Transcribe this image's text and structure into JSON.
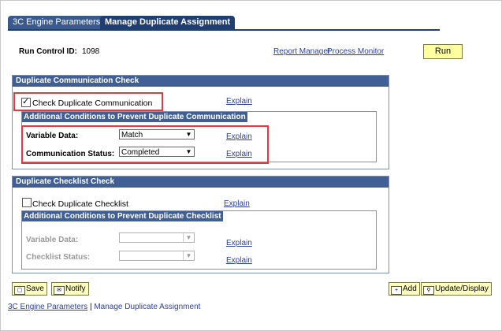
{
  "tabs": [
    {
      "label": "3C Engine Parameters",
      "active": false
    },
    {
      "label": "Manage Duplicate Assignment",
      "active": true
    }
  ],
  "run_control": {
    "label": "Run Control ID:",
    "value": "1098"
  },
  "header_links": {
    "report_manager": "Report Manager",
    "process_monitor": "Process Monitor",
    "run": "Run"
  },
  "comm_check": {
    "title": "Duplicate Communication Check",
    "checkbox_label": "Check Duplicate Communication",
    "checked": true,
    "explain": "Explain",
    "sub_title": "Additional Conditions to Prevent Duplicate Communication",
    "variable_data_label": "Variable Data:",
    "variable_data_value": "Match",
    "status_label": "Communication Status:",
    "status_value": "Completed"
  },
  "checklist_check": {
    "title": "Duplicate Checklist Check",
    "checkbox_label": "Check Duplicate Checklist",
    "checked": false,
    "explain": "Explain",
    "sub_title": "Additional Conditions to Prevent Duplicate Checklist",
    "variable_data_label": "Variable Data:",
    "variable_data_value": "",
    "status_label": "Checklist Status:",
    "status_value": ""
  },
  "toolbar": {
    "save": "Save",
    "notify": "Notify",
    "add": "Add",
    "update": "Update/Display"
  },
  "footer": {
    "link1": "3C Engine Parameters",
    "separator": " | ",
    "link2": "Manage Duplicate Assignment"
  },
  "colors": {
    "header_blue": "#3f5f95",
    "highlight_red": "#e23b3b",
    "button_yellow": "#ffffa0",
    "link_blue": "#2a3f9c"
  }
}
